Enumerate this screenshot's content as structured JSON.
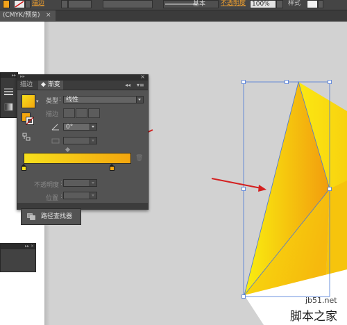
{
  "control_bar": {
    "stroke_label": "描边",
    "stroke_style_label": "基本",
    "opacity_label": "不透明度",
    "opacity_value": "100%",
    "style_label": "样式",
    "fill_color": "#f3a31b"
  },
  "document_tab": {
    "title": "(CMYK/预览)",
    "close": "×"
  },
  "gradient_panel": {
    "tab_stroke": "描边",
    "tab_gradient": "渐变",
    "collapse_glyph": "◂◂",
    "menu_glyph": "▾≡",
    "close_glyph": "×",
    "type_label": "类型",
    "type_value": "线性",
    "stroke_label": "描边",
    "angle_value": "0°",
    "opacity_label": "不透明度",
    "position_label": "位置",
    "gradient_colors": [
      "#f7e01c",
      "#f4a60e"
    ],
    "stop_colors": [
      "#f7e01c",
      "#f4a60e"
    ]
  },
  "pathfinder_tab": {
    "label": "路径查找器"
  },
  "artwork": {
    "shape_colors": [
      "#f9ef10",
      "#f29c0d"
    ],
    "selection_color": "#4a78d8",
    "annotation_color": "#d42020"
  },
  "watermark": {
    "url": "jb51.net",
    "name": "脚本之家"
  }
}
